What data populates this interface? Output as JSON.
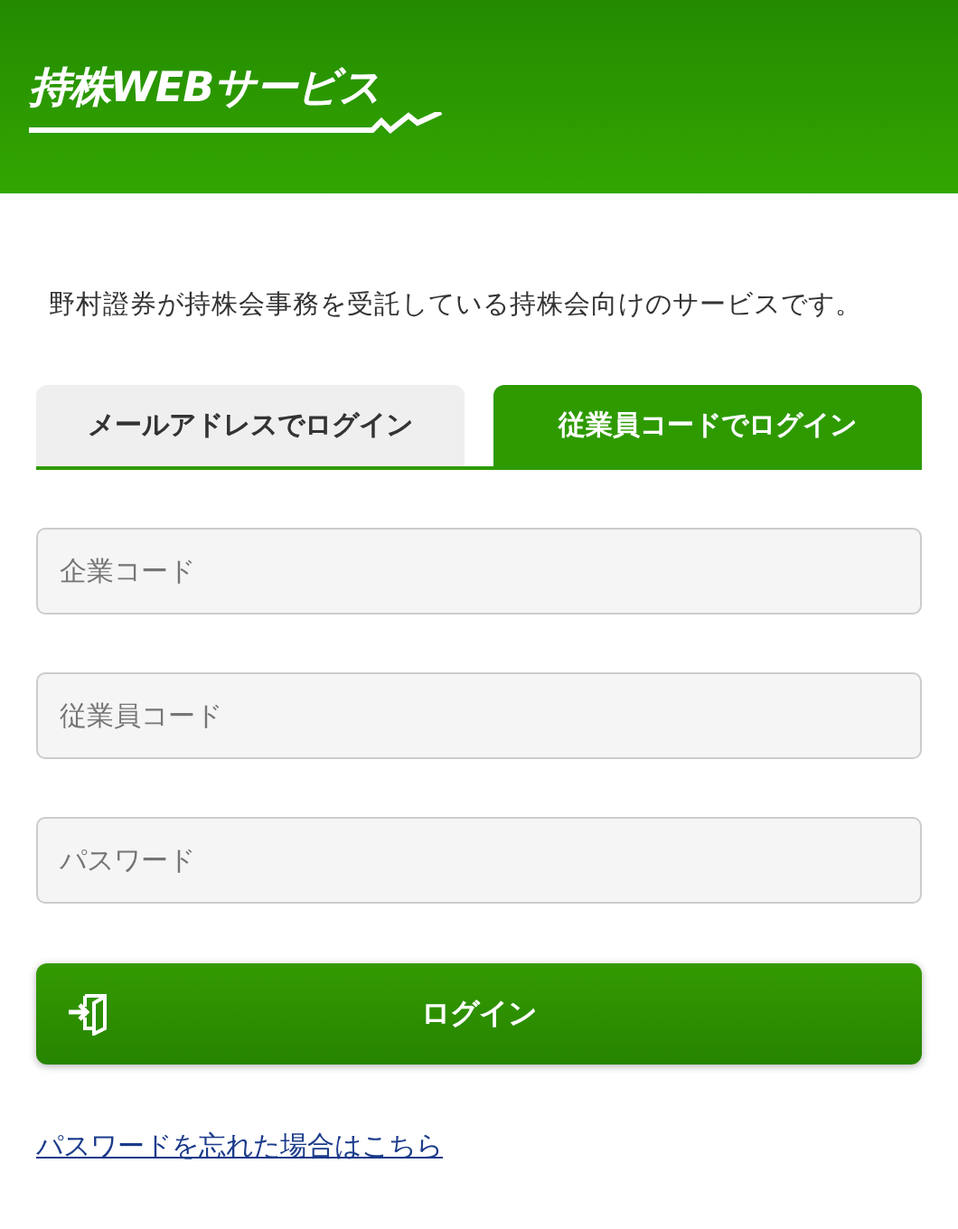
{
  "header": {
    "logo": "持株WEBサービス"
  },
  "intro": "野村證券が持株会事務を受託している持株会向けのサービスです。",
  "tabs": [
    {
      "label": "メールアドレスでログイン",
      "selected": false
    },
    {
      "label": "従業員コードでログイン",
      "selected": true
    }
  ],
  "fields": [
    {
      "placeholder": "企業コード"
    },
    {
      "placeholder": "従業員コード"
    },
    {
      "placeholder": "パスワード"
    }
  ],
  "login_button": "ログイン",
  "forgot_link": "パスワードを忘れた場合はこちら"
}
